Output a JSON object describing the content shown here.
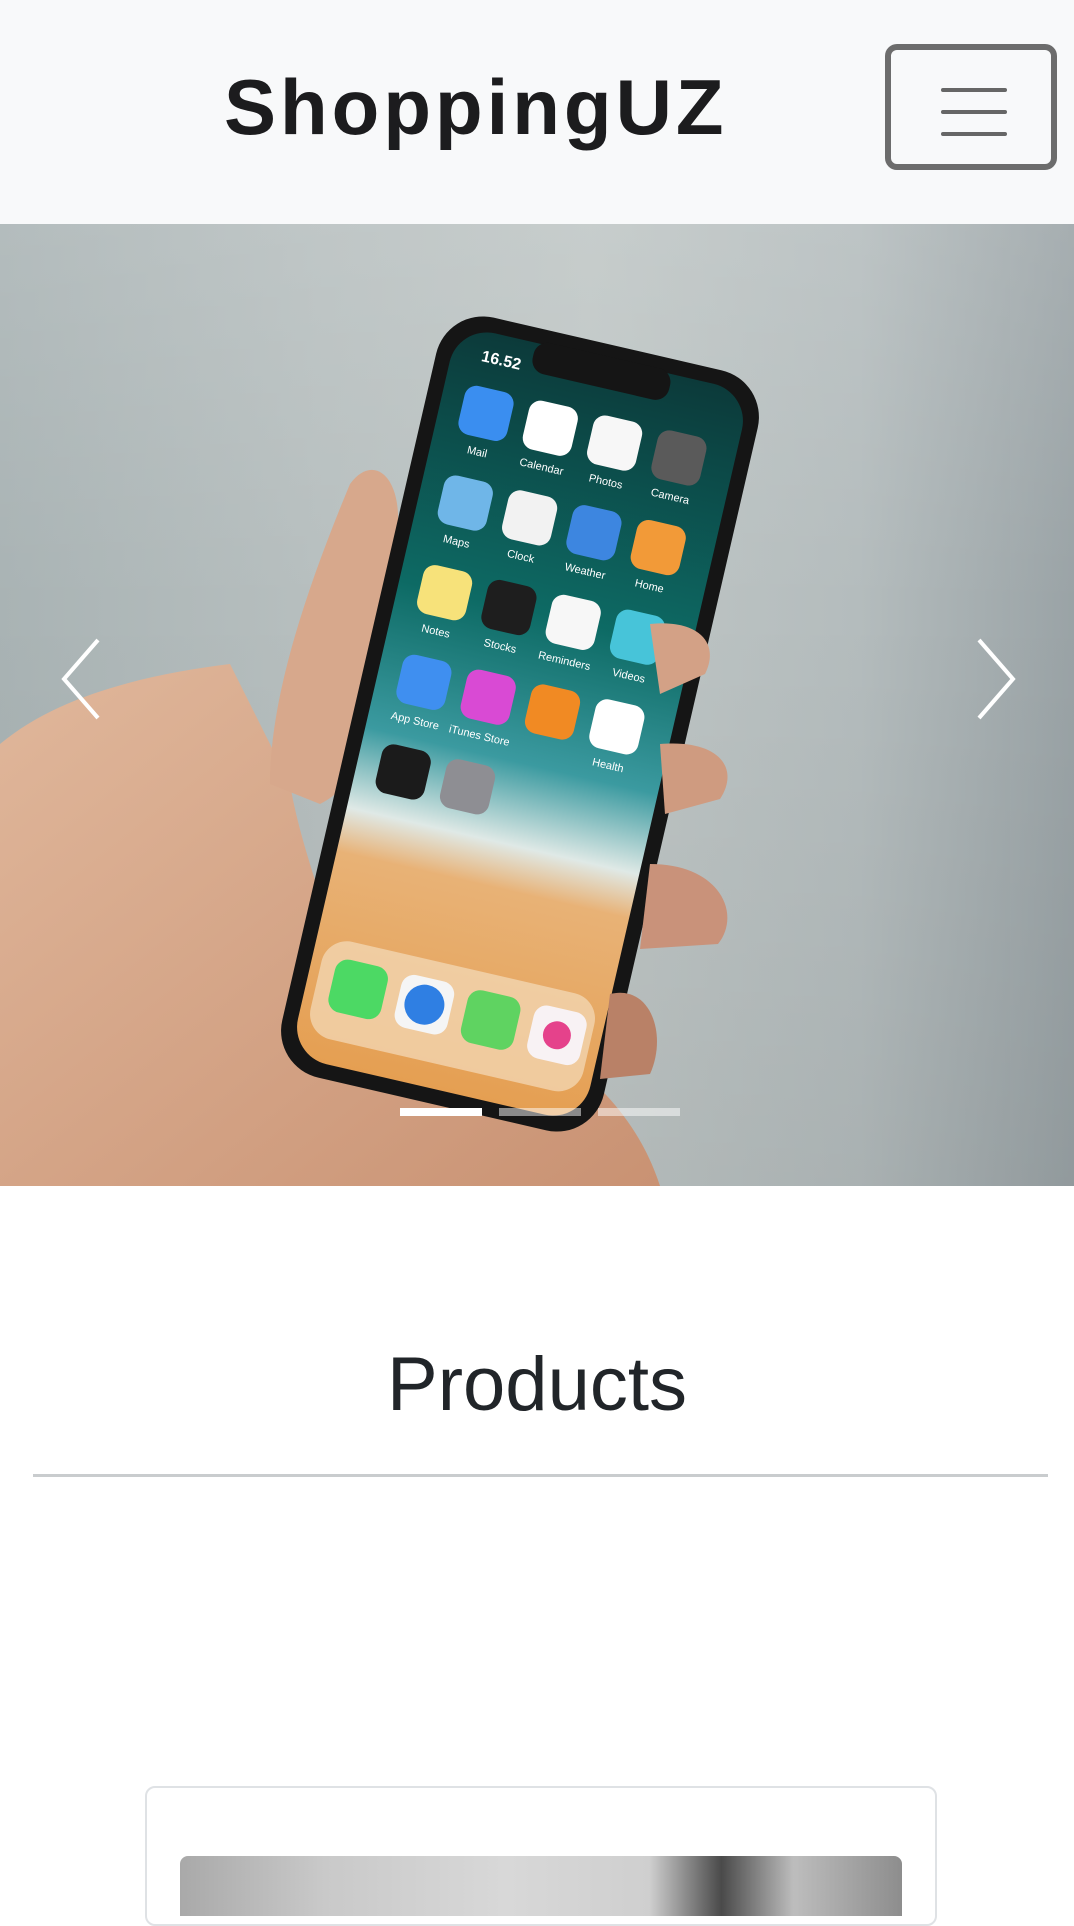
{
  "navbar": {
    "brand": "ShoppingUZ",
    "toggler_icon": "hamburger-menu-icon"
  },
  "carousel": {
    "slide_count": 3,
    "active_slide": 1,
    "prev_icon": "chevron-left-icon",
    "next_icon": "chevron-right-icon",
    "phone_status_time": "16.52",
    "apps": [
      {
        "label": "Mail"
      },
      {
        "label": "Calendar"
      },
      {
        "label": "Photos"
      },
      {
        "label": "Camera"
      },
      {
        "label": "Maps"
      },
      {
        "label": "Clock"
      },
      {
        "label": "Weather"
      },
      {
        "label": "Home"
      },
      {
        "label": "Notes"
      },
      {
        "label": "Stocks"
      },
      {
        "label": "Reminders"
      },
      {
        "label": "Videos"
      },
      {
        "label": "App Store"
      },
      {
        "label": "iTunes Store"
      },
      {
        "label": ""
      },
      {
        "label": "Health"
      }
    ]
  },
  "products": {
    "title": "Products"
  }
}
